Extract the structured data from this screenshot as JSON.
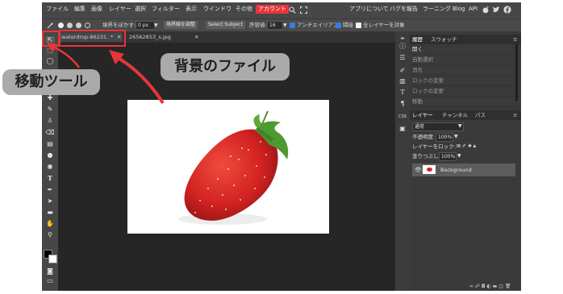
{
  "menubar": {
    "left_items": [
      "ファイル",
      "編集",
      "画像",
      "レイヤー",
      "選択",
      "フィルター",
      "表示",
      "ウインドウ",
      "その他"
    ],
    "active_item": "アカウント",
    "right_items": [
      "アプリについて",
      "バグを報告",
      "ラーニング",
      "Blog",
      "API"
    ]
  },
  "options": {
    "feather_label": "境界をぼかす:",
    "feather_value": "0 px",
    "refine_edge": "境界線を調整",
    "select_subject": "Select Subject",
    "tolerance_label": "許容値:",
    "tolerance_value": "16",
    "antialias": "アンチエイリアス",
    "contiguous": "隣接",
    "all_layers": "全レイヤーを対象"
  },
  "tabs": [
    {
      "label": "waterdrop-86231...",
      "modified": "*"
    },
    {
      "label": "26562853_s.jpg"
    }
  ],
  "history": {
    "tab_history": "履歴",
    "tab_swatches": "スウォッチ",
    "items": [
      "開く",
      "自動選択",
      "消去",
      "ロックの変更",
      "ロックの変更",
      "移動"
    ]
  },
  "layers": {
    "tab_layers": "レイヤー",
    "tab_channels": "チャンネル",
    "tab_paths": "パス",
    "blend_mode": "通常",
    "opacity_label": "不透明度",
    "opacity_value": "100%",
    "lock_label": "レイヤーをロック:",
    "fill_label": "塗りつぶし",
    "fill_value": "100%",
    "items": [
      {
        "name": "Background"
      }
    ]
  },
  "iconstrip": {
    "css_label": "CSS"
  },
  "annotations": {
    "move_tool": "移動ツール",
    "bg_file": "背景のファイル"
  },
  "colors": {
    "accent_red": "#e8353a",
    "callout_gray": "#aaaaaa",
    "app_dark": "#262626"
  }
}
